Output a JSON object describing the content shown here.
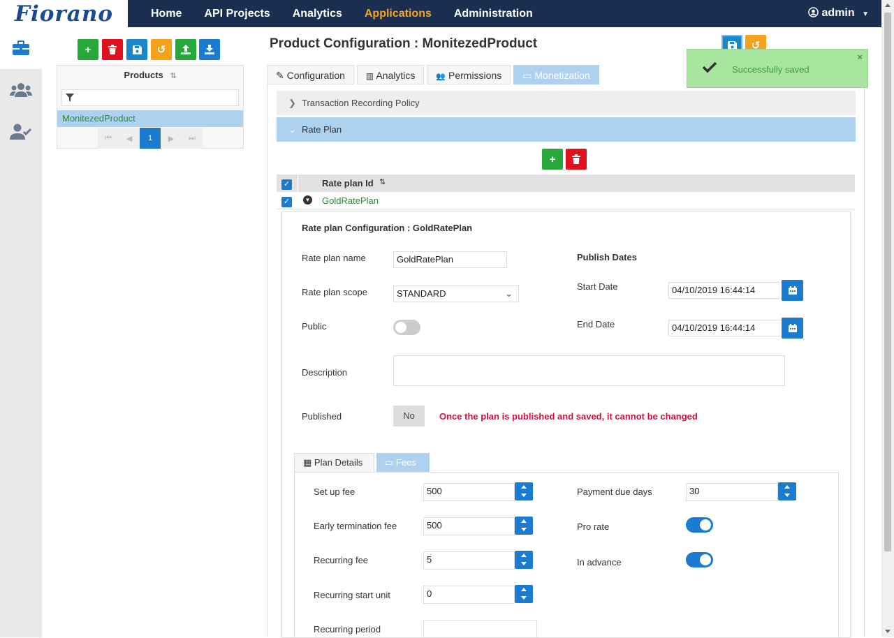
{
  "logo": "Fiorano",
  "nav": {
    "home": "Home",
    "api_projects": "API Projects",
    "analytics": "Analytics",
    "applications": "Applications",
    "administration": "Administration"
  },
  "user": {
    "name": "admin"
  },
  "products_panel": {
    "header": "Products",
    "filter_value": "",
    "items": [
      "MonitezedProduct"
    ],
    "current_page": "1"
  },
  "page_title": "Product Configuration : MonitezedProduct",
  "tabs": [
    "Configuration",
    "Analytics",
    "Permissions",
    "Monetization"
  ],
  "accordion": {
    "transaction": "Transaction Recording Policy",
    "rate_plan": "Rate Plan"
  },
  "grid": {
    "header": "Rate plan Id",
    "rows": [
      "GoldRatePlan"
    ]
  },
  "detail": {
    "heading": "Rate plan Configuration : GoldRatePlan",
    "rate_plan_name_label": "Rate plan name",
    "rate_plan_name_value": "GoldRatePlan",
    "scope_label": "Rate plan scope",
    "scope_value": "STANDARD",
    "public_label": "Public",
    "description_label": "Description",
    "published_label": "Published",
    "published_value": "No",
    "warning": "Once the plan is published and saved, it cannot be changed",
    "publish_dates_heading": "Publish Dates",
    "start_date_label": "Start Date",
    "start_date_value": "04/10/2019 16:44:14",
    "end_date_label": "End Date",
    "end_date_value": "04/10/2019 16:44:14"
  },
  "subtabs": [
    "Plan Details",
    "Fees"
  ],
  "fees": {
    "setup_label": "Set up fee",
    "setup_value": "500",
    "early_label": "Early termination fee",
    "early_value": "500",
    "recurring_label": "Recurring fee",
    "recurring_value": "5",
    "start_unit_label": "Recurring start unit",
    "start_unit_value": "0",
    "period_label": "Recurring period",
    "period_value": "",
    "due_days_label": "Payment due days",
    "due_days_value": "30",
    "pro_rate_label": "Pro rate",
    "in_advance_label": "In advance"
  },
  "toast": {
    "message": "Successfully saved"
  }
}
